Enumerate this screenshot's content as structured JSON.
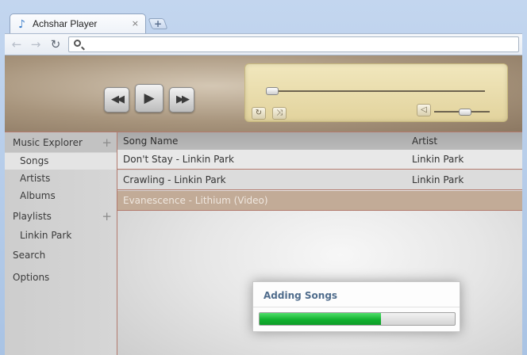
{
  "browser": {
    "tab_title": "Achshar Player",
    "tab_close": "×",
    "new_tab": "+",
    "back": "←",
    "forward": "→",
    "reload": "↻",
    "address_value": "",
    "address_placeholder": ""
  },
  "player": {
    "prev": "◀◀",
    "play": "▶",
    "next": "▶▶",
    "repeat": "↻",
    "shuffle": "⤨",
    "volume": "◁",
    "seek_progress": 0.0,
    "volume_level": 0.55
  },
  "sidebar": {
    "music_explorer": "Music Explorer",
    "music_explorer_add": "+",
    "songs": "Songs",
    "artists": "Artists",
    "albums": "Albums",
    "playlists": "Playlists",
    "playlists_add": "+",
    "playlist_1": "Linkin Park",
    "search": "Search",
    "options": "Options"
  },
  "table": {
    "col_name": "Song Name",
    "col_artist": "Artist",
    "rows": [
      {
        "name": "Don't Stay - Linkin Park",
        "artist": "Linkin Park"
      },
      {
        "name": "Crawling - Linkin Park",
        "artist": "Linkin Park"
      },
      {
        "name": "Evanescence - Lithium (Video)",
        "artist": ""
      }
    ]
  },
  "dialog": {
    "title": "Adding Songs",
    "progress": 0.62
  },
  "colors": {
    "accent_border": "#b37b6e",
    "progress_green": "#12b230",
    "dialog_title": "#4f6c8c"
  }
}
